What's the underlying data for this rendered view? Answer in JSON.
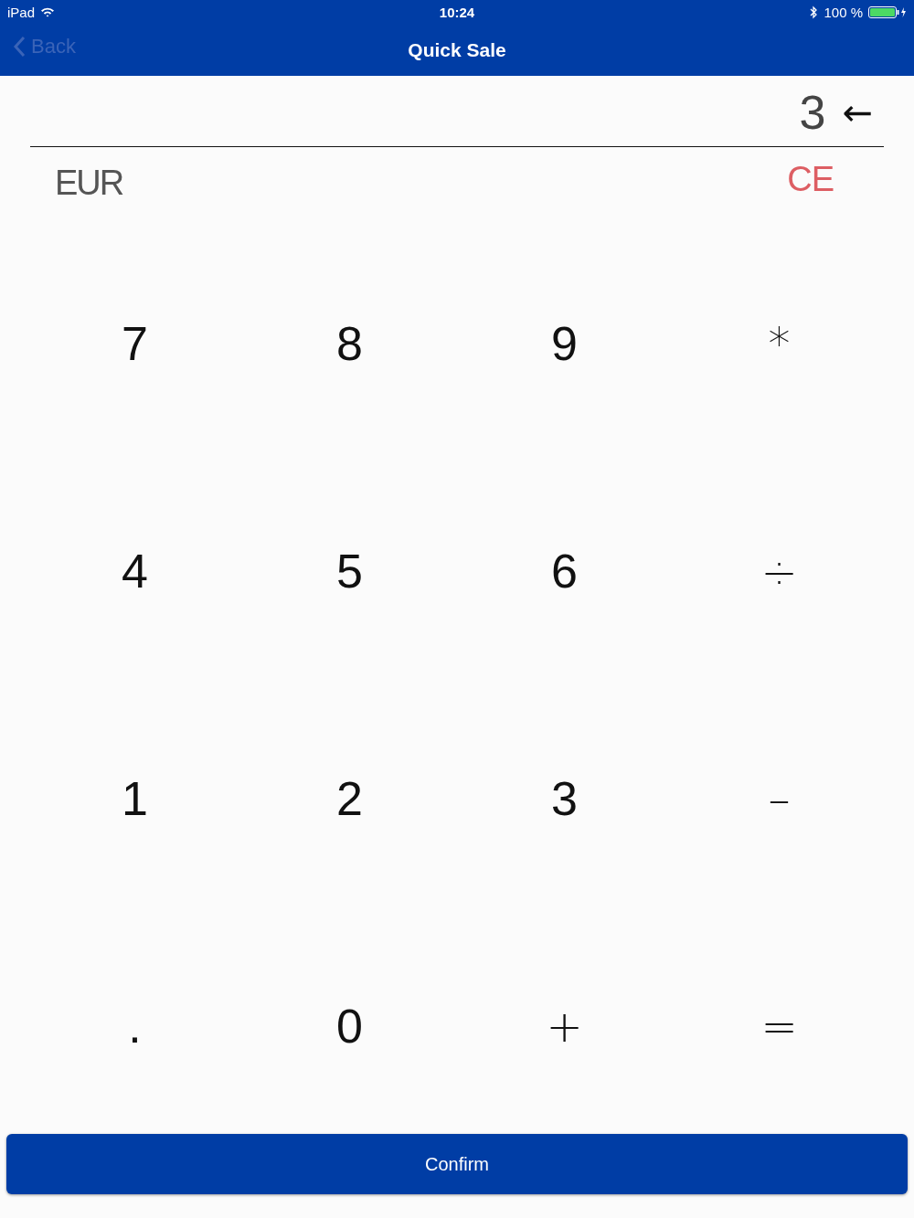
{
  "status_bar": {
    "device": "iPad",
    "time": "10:24",
    "battery": "100 %"
  },
  "nav_bar": {
    "back": {
      "label": "Back",
      "disabled": true
    },
    "title": "Quick Sale"
  },
  "display": {
    "value": "3",
    "backspace": "←"
  },
  "currency": "EUR",
  "clear": "CE",
  "keys": [
    {
      "label": "7",
      "kind": "digit"
    },
    {
      "label": "8",
      "kind": "digit"
    },
    {
      "label": "9",
      "kind": "digit"
    },
    {
      "label": "*",
      "kind": "operator"
    },
    {
      "label": "4",
      "kind": "digit"
    },
    {
      "label": "5",
      "kind": "digit"
    },
    {
      "label": "6",
      "kind": "digit"
    },
    {
      "label": "÷",
      "kind": "operator"
    },
    {
      "label": "1",
      "kind": "digit"
    },
    {
      "label": "2",
      "kind": "digit"
    },
    {
      "label": "3",
      "kind": "digit"
    },
    {
      "label": "–",
      "kind": "operator"
    },
    {
      "label": ".",
      "kind": "digit"
    },
    {
      "label": "0",
      "kind": "digit"
    },
    {
      "label": "+",
      "kind": "operator"
    },
    {
      "label": "=",
      "kind": "operator"
    }
  ],
  "confirm": "Confirm"
}
